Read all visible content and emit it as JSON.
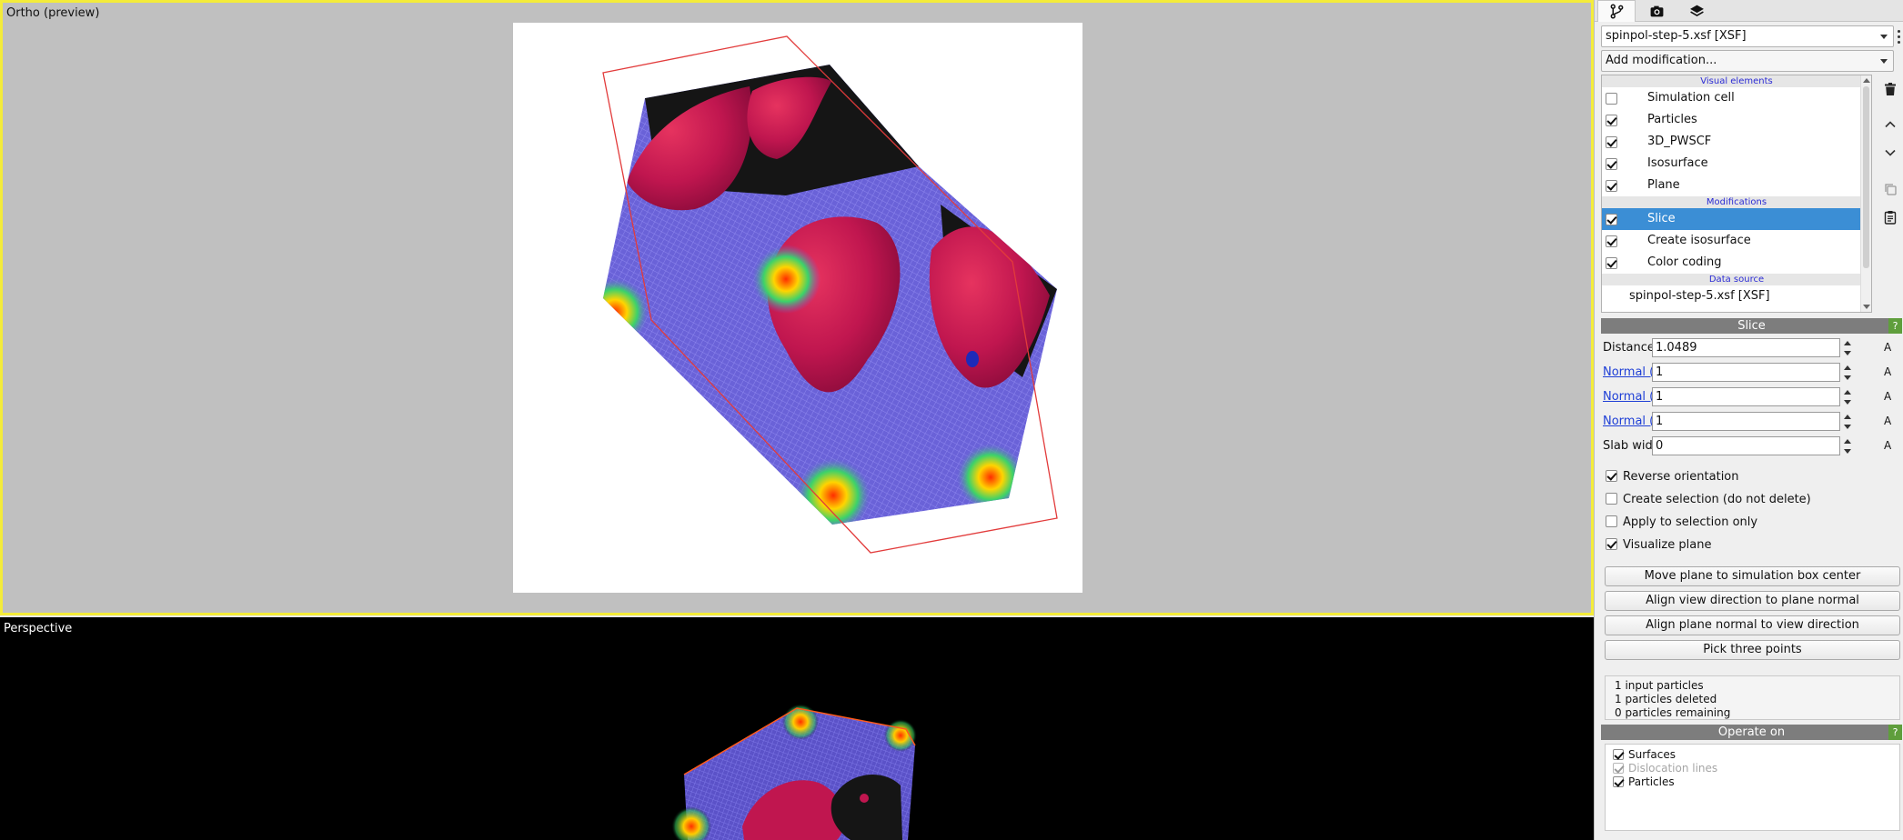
{
  "viewports": {
    "top_caption": "Ortho (preview)",
    "bottom_caption": "Perspective"
  },
  "colors": {
    "active_viewport_border": "#f4ec3a",
    "selection": "#3b8ed5",
    "section_header": "#7d7d7d",
    "help_button": "#5f9e3c",
    "link": "#1e3fd6",
    "list_header_text": "#2b2bd4"
  },
  "tabs": [
    {
      "name": "pipeline-tab",
      "icon": "pipeline-icon"
    },
    {
      "name": "render-tab",
      "icon": "camera-icon"
    },
    {
      "name": "overlays-tab",
      "icon": "layers-icon"
    }
  ],
  "pipeline": {
    "selector": "spinpol-step-5.xsf [XSF]",
    "add_modification": "Add modification...",
    "headers": {
      "visual": "Visual elements",
      "modifications": "Modifications",
      "source": "Data source"
    },
    "visual_elements": [
      {
        "label": "Simulation cell",
        "checked": false
      },
      {
        "label": "Particles",
        "checked": true
      },
      {
        "label": "3D_PWSCF",
        "checked": true
      },
      {
        "label": "Isosurface",
        "checked": true
      },
      {
        "label": "Plane",
        "checked": true
      }
    ],
    "modifications": [
      {
        "label": "Slice",
        "checked": true
      },
      {
        "label": "Create isosurface",
        "checked": true
      },
      {
        "label": "Color coding",
        "checked": true
      }
    ],
    "data_source": "spinpol-step-5.xsf [XSF]"
  },
  "slice": {
    "title": "Slice",
    "help": "?",
    "params": [
      {
        "label": "Distance:",
        "value": "1.0489",
        "unit": "A",
        "link": false
      },
      {
        "label": "Normal (X):",
        "value": "1",
        "unit": "A",
        "link": true
      },
      {
        "label": "Normal (Y):",
        "value": "1",
        "unit": "A",
        "link": true
      },
      {
        "label": "Normal (Z):",
        "value": "1",
        "unit": "A",
        "link": true
      },
      {
        "label": "Slab width:",
        "value": "0",
        "unit": "A",
        "link": false
      }
    ],
    "options": [
      {
        "label": "Reverse orientation",
        "checked": true
      },
      {
        "label": "Create selection (do not delete)",
        "checked": false
      },
      {
        "label": "Apply to selection only",
        "checked": false
      },
      {
        "label": "Visualize plane",
        "checked": true
      }
    ],
    "buttons": {
      "move_center": "Move plane to simulation box center",
      "align_view": "Align view direction to plane normal",
      "align_plane": "Align plane normal to view direction",
      "pick_points": "Pick three points"
    },
    "status": {
      "input": "1 input particles",
      "deleted": "1 particles deleted",
      "remaining": "0 particles remaining"
    }
  },
  "operate_on": {
    "title": "Operate on",
    "help": "?",
    "items": [
      {
        "label": "Surfaces",
        "checked": true,
        "enabled": true
      },
      {
        "label": "Dislocation lines",
        "checked": true,
        "enabled": false
      },
      {
        "label": "Particles",
        "checked": true,
        "enabled": true
      }
    ]
  }
}
